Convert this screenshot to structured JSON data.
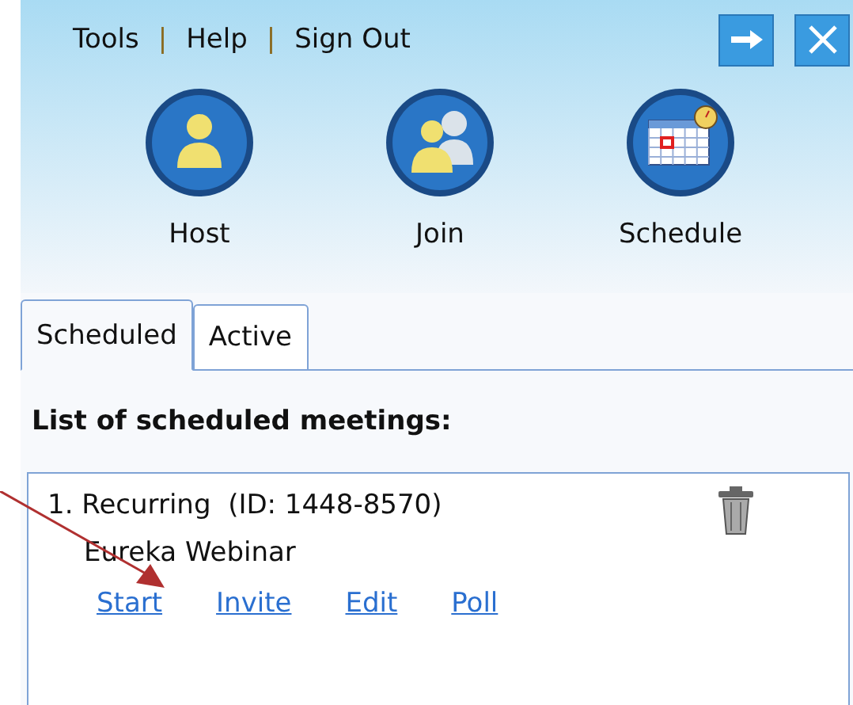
{
  "menu": [
    "Tools",
    "Help",
    "Sign Out"
  ],
  "menu_separator": "|",
  "actions": [
    {
      "label": "Host",
      "kind": "host"
    },
    {
      "label": "Join",
      "kind": "join"
    },
    {
      "label": "Schedule",
      "kind": "schedule"
    }
  ],
  "tabs": [
    {
      "label": "Scheduled",
      "selected": true
    },
    {
      "label": "Active",
      "selected": false
    }
  ],
  "heading": "List of scheduled meetings:",
  "meetings": [
    {
      "number": "1.",
      "type": "Recurring",
      "id": "(ID: 1448-8570)",
      "name": "Eureka Webinar",
      "links": [
        "Start",
        "Invite",
        "Edit",
        "Poll"
      ]
    }
  ]
}
